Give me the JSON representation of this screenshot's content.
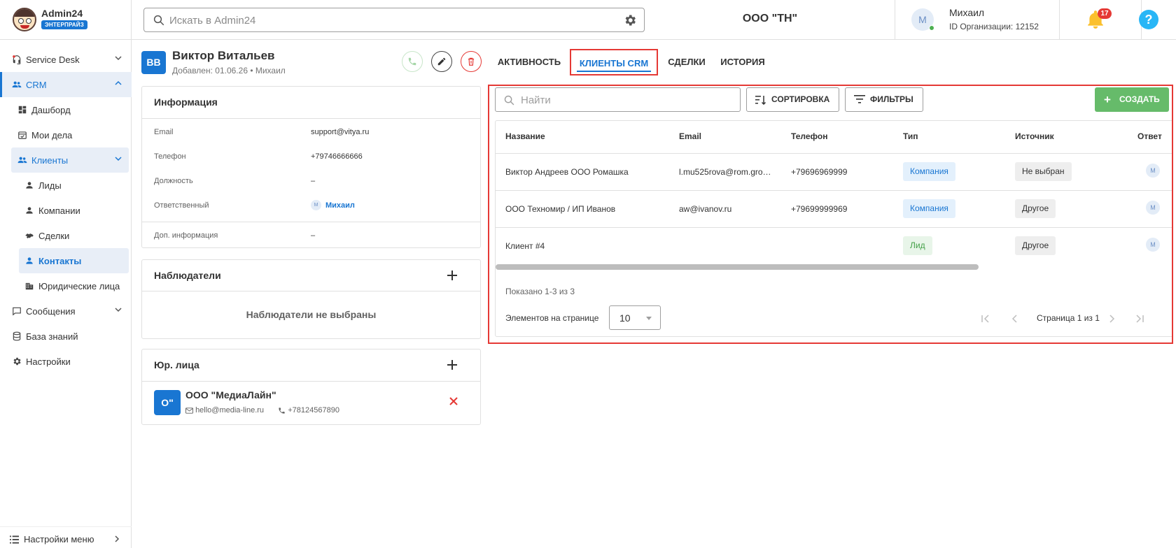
{
  "brand": {
    "name": "Admin24",
    "badge": "ЭНТЕРПРАЙЗ"
  },
  "search": {
    "placeholder": "Искать в Admin24"
  },
  "org": {
    "name": "ООО \"ТН\""
  },
  "user": {
    "initial": "М",
    "name": "Михаил",
    "org_id": "ID Организации: 12152"
  },
  "notifications": {
    "count": "17"
  },
  "help": {
    "label": "?"
  },
  "sidebar": {
    "items": [
      {
        "label": "Service Desk",
        "icon": "headset-icon"
      },
      {
        "label": "CRM",
        "icon": "users-icon"
      },
      {
        "label": "Дашборд",
        "icon": "dashboard-icon"
      },
      {
        "label": "Мои дела",
        "icon": "calendar-check-icon"
      },
      {
        "label": "Клиенты",
        "icon": "users-icon"
      },
      {
        "label": "Лиды",
        "icon": "person-icon"
      },
      {
        "label": "Компании",
        "icon": "person-icon"
      },
      {
        "label": "Сделки",
        "icon": "handshake-icon"
      },
      {
        "label": "Контакты",
        "icon": "person-icon"
      },
      {
        "label": "Юридические лица",
        "icon": "building-icon"
      },
      {
        "label": "Сообщения",
        "icon": "chat-icon"
      },
      {
        "label": "База знаний",
        "icon": "database-icon"
      },
      {
        "label": "Настройки",
        "icon": "gear-icon"
      }
    ],
    "menu_settings": "Настройки меню"
  },
  "contact": {
    "initials": "ВВ",
    "name": "Виктор Витальев",
    "added": "Добавлен: 01.06.26 • Михаил"
  },
  "info": {
    "title": "Информация",
    "rows": [
      {
        "key": "Email",
        "value": "support@vitya.ru"
      },
      {
        "key": "Телефон",
        "value": "+79746666666"
      },
      {
        "key": "Должность",
        "value": "–"
      },
      {
        "key": "Ответственный",
        "value": "Михаил",
        "avatar": "М"
      },
      {
        "key": "Доп. информация",
        "value": "–"
      }
    ]
  },
  "observers": {
    "title": "Наблюдатели",
    "empty": "Наблюдатели не выбраны"
  },
  "legal": {
    "title": "Юр. лица",
    "item": {
      "initials": "О\"",
      "name": "ООО \"МедиаЛайн\"",
      "email": "hello@media-line.ru",
      "phone": "+78124567890"
    }
  },
  "tabs": [
    "АКТИВНОСТЬ",
    "КЛИЕНТЫ CRM",
    "СДЕЛКИ",
    "ИСТОРИЯ"
  ],
  "crm": {
    "search_placeholder": "Найти",
    "sort_label": "СОРТИРОВКА",
    "filters_label": "ФИЛЬТРЫ",
    "create_label": "СОЗДАТЬ",
    "columns": [
      "Название",
      "Email",
      "Телефон",
      "Тип",
      "Источник",
      "Ответ"
    ],
    "rows": [
      {
        "name": "Виктор Андреев ООО Ромашка",
        "email": "l.mu525rova@rom.gro…",
        "phone": "+79696969999",
        "type": "Компания",
        "source": "Не выбран",
        "resp": "М"
      },
      {
        "name": "ООО Техномир / ИП Иванов",
        "email": "aw@ivanov.ru",
        "phone": "+79699999969",
        "type": "Компания",
        "source": "Другое",
        "resp": "М"
      },
      {
        "name": "Клиент #4",
        "email": "",
        "phone": "",
        "type": "Лид",
        "source": "Другое",
        "resp": "М"
      }
    ],
    "shown": "Показано 1-3 из 3",
    "per_page_label": "Элементов на странице",
    "per_page_value": "10",
    "page_info": "Страница 1 из 1"
  },
  "colors": {
    "accent": "#1976d2",
    "highlight": "#e53935",
    "create": "#66bb6a"
  }
}
